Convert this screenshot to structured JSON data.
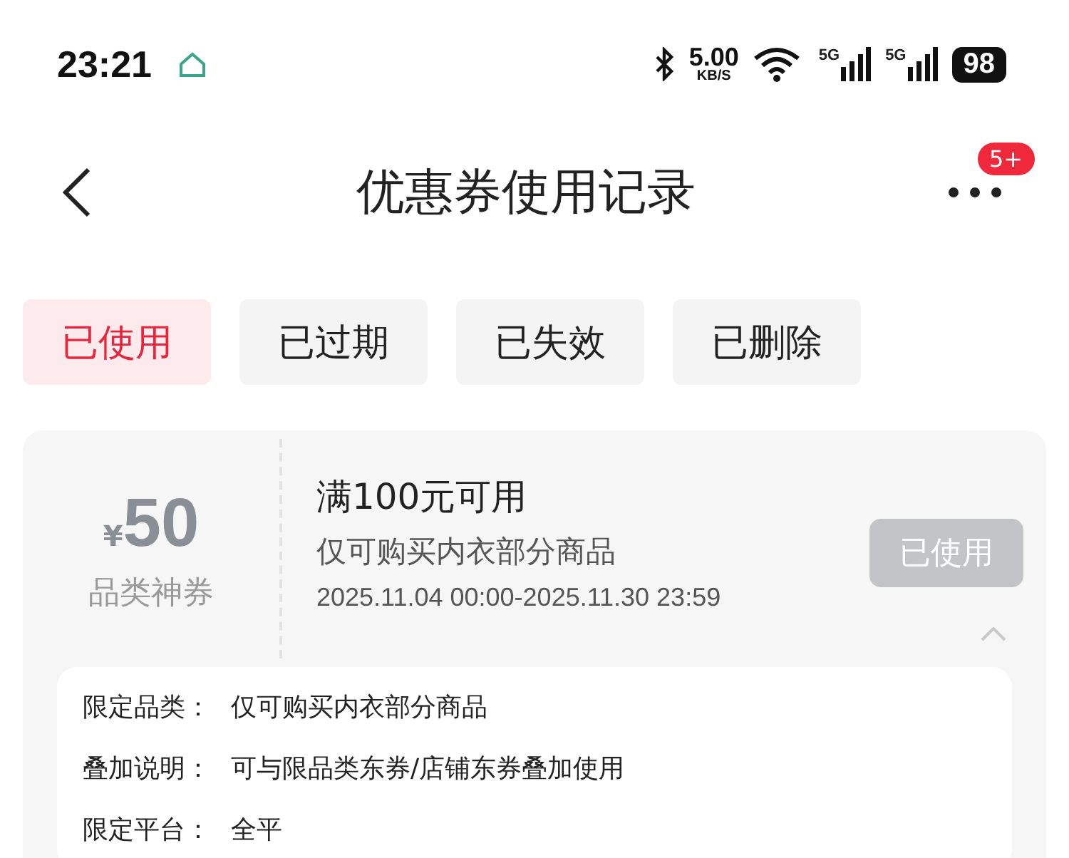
{
  "status_bar": {
    "time": "23:21",
    "speed_value": "5.00",
    "speed_unit": "KB/S",
    "network_1": "5G",
    "network_2": "5G",
    "battery": "98"
  },
  "header": {
    "title": "优惠券使用记录",
    "badge": "5+"
  },
  "tabs": [
    {
      "label": "已使用",
      "selected": true
    },
    {
      "label": "已过期",
      "selected": false
    },
    {
      "label": "已失效",
      "selected": false
    },
    {
      "label": "已删除",
      "selected": false
    }
  ],
  "coupon": {
    "currency": "¥",
    "amount": "50",
    "type": "品类神券",
    "condition": "满100元可用",
    "scope": "仅可购买内衣部分商品",
    "validity": "2025.11.04 00:00-2025.11.30 23:59",
    "status": "已使用",
    "expanded": true,
    "details": [
      {
        "label": "限定品类：",
        "value": "仅可购买内衣部分商品"
      },
      {
        "label": "叠加说明：",
        "value": "可与限品类东券/店铺东券叠加使用"
      },
      {
        "label": "限定平台：",
        "value": "全平"
      }
    ]
  }
}
